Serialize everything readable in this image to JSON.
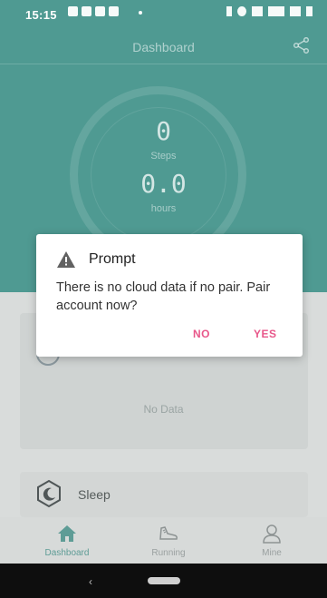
{
  "status_bar": {
    "time": "15:15"
  },
  "header": {
    "title": "Dashboard",
    "share_icon": "share-icon"
  },
  "summary": {
    "steps_value": "0",
    "steps_label": "Steps",
    "hours_value": "0.0",
    "hours_label": "hours"
  },
  "card": {
    "no_data": "No Data"
  },
  "sleep": {
    "label": "Sleep",
    "icon": "sleep-moon-icon"
  },
  "bottom_nav": {
    "items": [
      {
        "label": "Dashboard",
        "icon": "home-icon",
        "active": true
      },
      {
        "label": "Running",
        "icon": "running-shoe-icon",
        "active": false
      },
      {
        "label": "Mine",
        "icon": "person-icon",
        "active": false
      }
    ]
  },
  "dialog": {
    "title": "Prompt",
    "message": "There is no cloud data if no pair. Pair account now?",
    "no_label": "NO",
    "yes_label": "YES",
    "icon": "warning-icon"
  },
  "colors": {
    "teal": "#4f9a92",
    "accent": "#e8578a",
    "overlay": "#d9dcdb"
  }
}
